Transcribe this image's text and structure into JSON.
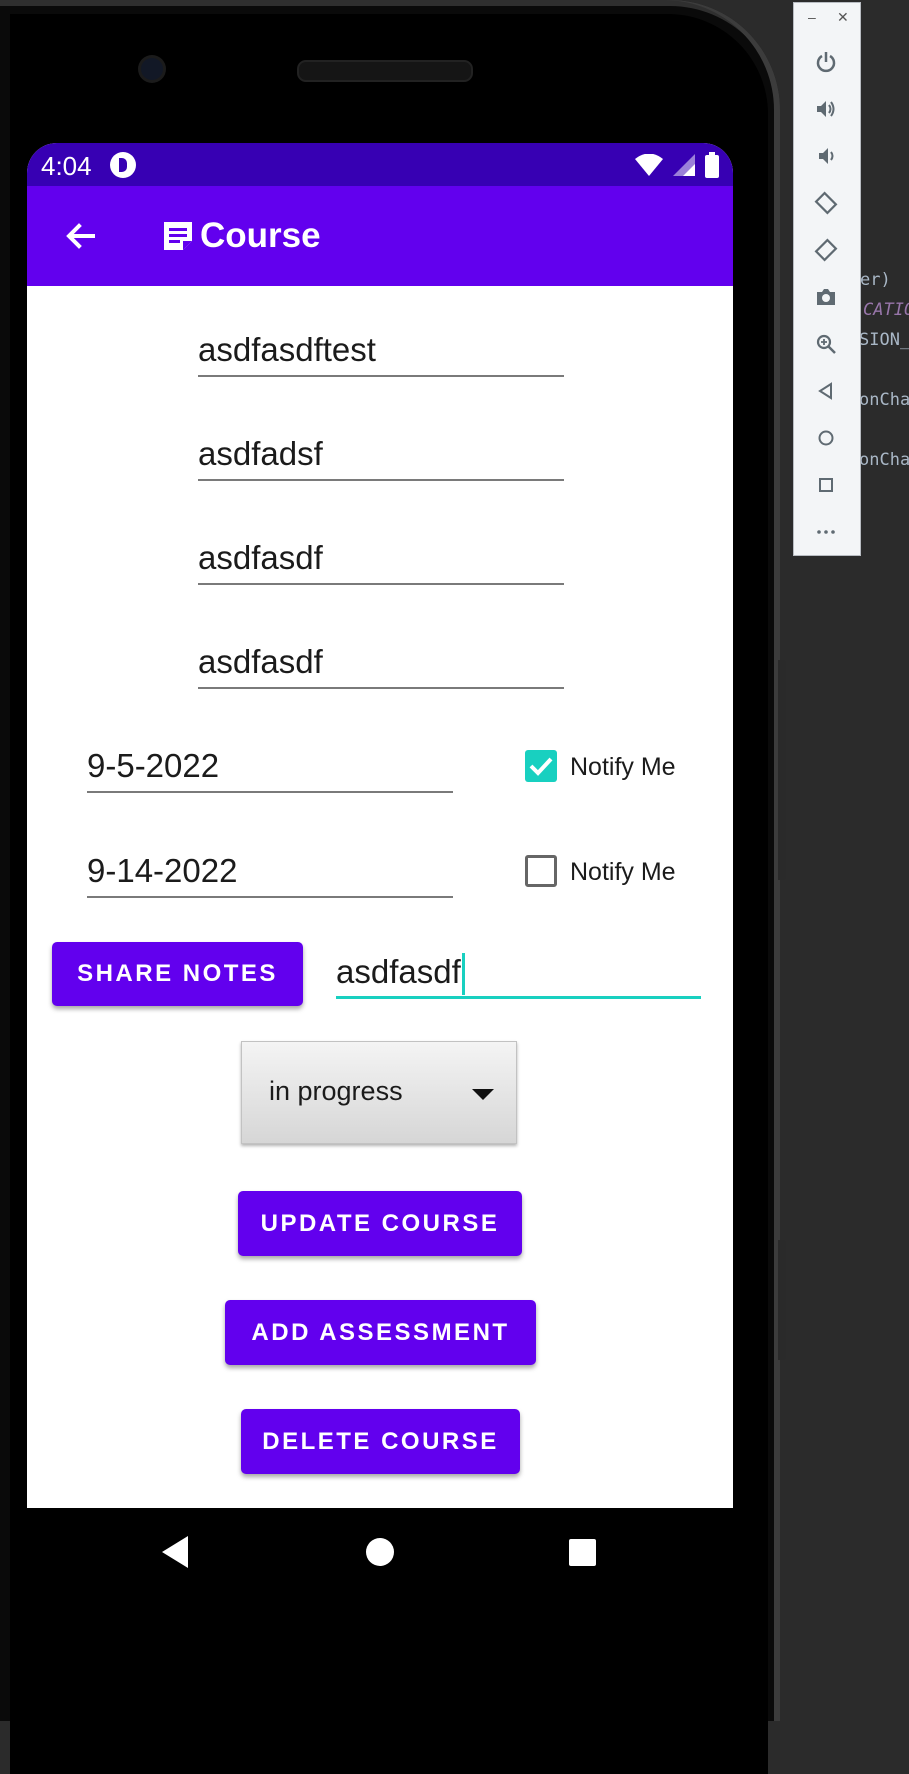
{
  "status_bar": {
    "time": "4:04"
  },
  "app_bar": {
    "title": "Course"
  },
  "form": {
    "title_value": "asdfasdftest",
    "instructor_name": "asdfadsf",
    "instructor_phone": "asdfasdf",
    "instructor_email": "asdfasdf",
    "start_date": "9-5-2022",
    "start_notify_label": "Notify Me",
    "start_notify_checked": true,
    "end_date": "9-14-2022",
    "end_notify_label": "Notify Me",
    "end_notify_checked": false,
    "share_notes_label": "SHARE NOTES",
    "notes_value": "asdfasdf",
    "status_selected": "in progress",
    "update_label": "UPDATE COURSE",
    "add_assessment_label": "ADD ASSESSMENT",
    "delete_label": "DELETE COURSE"
  },
  "ide_snippets": [
    "er) ",
    "CATIO",
    "SION_",
    "onCha",
    "onCha"
  ],
  "colors": {
    "primary": "#6200ee",
    "primary_dark": "#3700b3",
    "accent": "#18d0c0"
  }
}
